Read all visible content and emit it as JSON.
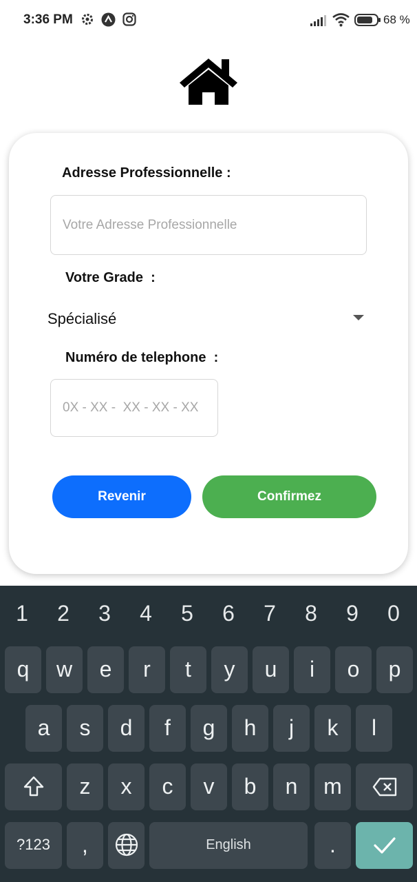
{
  "status_bar": {
    "time": "3:36 PM",
    "battery_percent": "68 %",
    "left_icons": [
      "settings-gear-icon",
      "arrow-up-circle-icon",
      "instagram-icon"
    ],
    "right_icons": [
      "signal-icon",
      "wifi-icon",
      "battery-icon"
    ]
  },
  "app": {
    "logo_icon": "house-icon"
  },
  "form": {
    "address": {
      "label": "Adresse Professionnelle :",
      "placeholder": "Votre Adresse Professionnelle",
      "value": ""
    },
    "grade": {
      "label": "Votre Grade  :",
      "selected": "Spécialisé"
    },
    "phone": {
      "label": "Numéro de telephone  :",
      "placeholder": "0X - XX -  XX - XX - XX",
      "value": ""
    },
    "buttons": {
      "back": "Revenir",
      "confirm": "Confirmez"
    },
    "colors": {
      "back": "#0d6efd",
      "confirm": "#4caf50"
    }
  },
  "keyboard": {
    "numbers": [
      "1",
      "2",
      "3",
      "4",
      "5",
      "6",
      "7",
      "8",
      "9",
      "0"
    ],
    "row1": [
      "q",
      "w",
      "e",
      "r",
      "t",
      "y",
      "u",
      "i",
      "o",
      "p"
    ],
    "row2": [
      "a",
      "s",
      "d",
      "f",
      "g",
      "h",
      "j",
      "k",
      "l"
    ],
    "row3": [
      "z",
      "x",
      "c",
      "v",
      "b",
      "n",
      "m"
    ],
    "symbols": "?123",
    "comma": ",",
    "period": ".",
    "space": "English",
    "special_icons": [
      "shift-icon",
      "backspace-icon",
      "globe-icon",
      "checkmark-icon"
    ],
    "colors": {
      "background": "#263238",
      "key": "#3d474e",
      "enter": "#6cb4ac"
    }
  }
}
